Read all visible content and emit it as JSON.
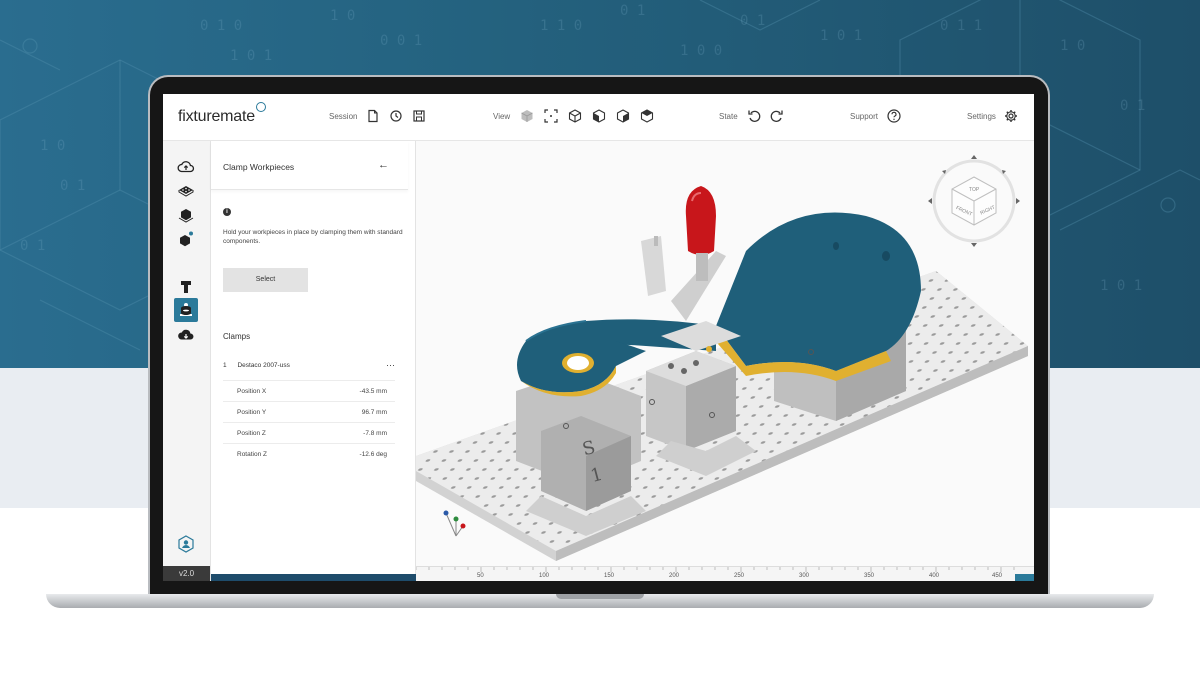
{
  "app": {
    "name": "fixturemate",
    "version": "v2.0"
  },
  "topbar": {
    "session_label": "Session",
    "view_label": "View",
    "state_label": "State",
    "support_label": "Support",
    "settings_label": "Settings",
    "session_icons": [
      "file-icon",
      "history-icon",
      "save-icon"
    ],
    "view_icons": [
      "solid-cube-icon",
      "fit-view-icon",
      "cube-iso-icon",
      "cube-front-icon",
      "cube-right-icon",
      "cube-top-icon"
    ],
    "state_icons": [
      "undo-icon",
      "redo-icon"
    ],
    "support_icon": "help-icon",
    "settings_icon": "gear-icon"
  },
  "rail": {
    "items": [
      "upload-cloud-icon",
      "baseplate-icon",
      "workpiece-icon",
      "components-icon",
      "clamp-icon",
      "t-slot-icon",
      "support-icon",
      "download-cloud-icon"
    ],
    "active_index": 4,
    "bottom_icon": "user-icon"
  },
  "panel": {
    "title": "Clamp Workpieces",
    "description": "Hold your workpieces in place by clamping them with standard components.",
    "select_label": "Select",
    "clamps_heading": "Clamps",
    "clamp": {
      "index": "1",
      "name": "Destaco 2007-uss",
      "more": "···",
      "properties": [
        {
          "label": "Position X",
          "value": "-43.5 mm"
        },
        {
          "label": "Position Y",
          "value": "96.7 mm"
        },
        {
          "label": "Position Z",
          "value": "-7.8 mm"
        },
        {
          "label": "Rotation Z",
          "value": "-12.6 deg"
        }
      ]
    }
  },
  "viewport": {
    "navcube_faces": [
      "TOP",
      "FRONT",
      "RIGHT"
    ],
    "part_text": [
      "S",
      "1"
    ],
    "ruler_ticks": [
      "50",
      "100",
      "150",
      "200",
      "250",
      "300",
      "350",
      "400",
      "450"
    ],
    "colors": {
      "accent": "#2b7a9a",
      "workpiece": "#1f5f7a",
      "workpiece_edge": "#e0b030",
      "fixture_grey": "#c8c8c8",
      "plate": "#ebebeb",
      "clamp_handle": "#c8161b"
    }
  }
}
